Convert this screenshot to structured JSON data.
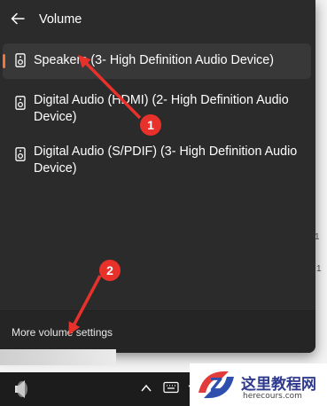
{
  "flyout": {
    "title": "Volume",
    "devices": [
      {
        "label": "Speakers (3- High Definition Audio Device)",
        "selected": true
      },
      {
        "label": "Digital Audio (HDMI) (2- High Definition Audio Device)",
        "selected": false
      },
      {
        "label": "Digital Audio (S/PDIF) (3- High Definition Audio Device)",
        "selected": false
      }
    ],
    "footer_link": "More volume settings"
  },
  "annotations": [
    {
      "number": "1",
      "color": "#e8312b"
    },
    {
      "number": "2",
      "color": "#e8312b"
    }
  ],
  "accent_color": "#f0763c",
  "watermark": {
    "site_name": "这里教程网",
    "site_url": "herecours.com"
  },
  "taskbar": {
    "icons": [
      "speaker-icon",
      "chevron-up-icon",
      "keyboard-icon",
      "wifi-icon"
    ]
  }
}
